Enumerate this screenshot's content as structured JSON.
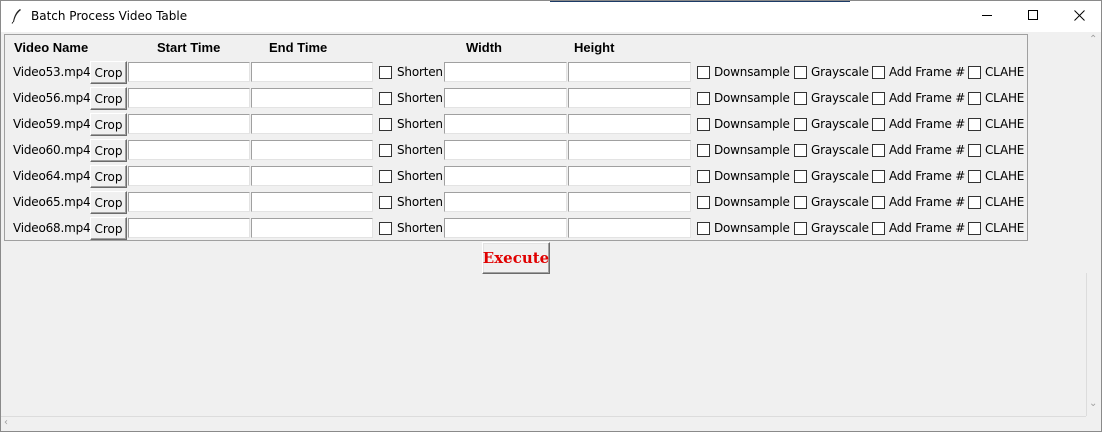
{
  "window": {
    "title": "Batch Process Video Table",
    "icons": {
      "app": "feather-icon",
      "minimize": "minimize-icon",
      "maximize": "maximize-icon",
      "close": "close-icon"
    }
  },
  "table": {
    "headers": {
      "video_name": "Video Name",
      "start_time": "Start Time",
      "end_time": "End Time",
      "width": "Width",
      "height": "Height"
    },
    "labels": {
      "crop": "Crop",
      "shorten": "Shorten",
      "downsample": "Downsample",
      "grayscale": "Grayscale",
      "add_frame": "Add Frame #",
      "clahe": "CLAHE"
    },
    "rows": [
      {
        "video": "Video53.mp4",
        "start": "",
        "end": "",
        "width": "",
        "height": "",
        "shorten": false,
        "downsample": false,
        "grayscale": false,
        "add_frame": false,
        "clahe": false
      },
      {
        "video": "Video56.mp4",
        "start": "",
        "end": "",
        "width": "",
        "height": "",
        "shorten": false,
        "downsample": false,
        "grayscale": false,
        "add_frame": false,
        "clahe": false
      },
      {
        "video": "Video59.mp4",
        "start": "",
        "end": "",
        "width": "",
        "height": "",
        "shorten": false,
        "downsample": false,
        "grayscale": false,
        "add_frame": false,
        "clahe": false
      },
      {
        "video": "Video60.mp4",
        "start": "",
        "end": "",
        "width": "",
        "height": "",
        "shorten": false,
        "downsample": false,
        "grayscale": false,
        "add_frame": false,
        "clahe": false
      },
      {
        "video": "Video64.mp4",
        "start": "",
        "end": "",
        "width": "",
        "height": "",
        "shorten": false,
        "downsample": false,
        "grayscale": false,
        "add_frame": false,
        "clahe": false
      },
      {
        "video": "Video65.mp4",
        "start": "",
        "end": "",
        "width": "",
        "height": "",
        "shorten": false,
        "downsample": false,
        "grayscale": false,
        "add_frame": false,
        "clahe": false
      },
      {
        "video": "Video68.mp4",
        "start": "",
        "end": "",
        "width": "",
        "height": "",
        "shorten": false,
        "downsample": false,
        "grayscale": false,
        "add_frame": false,
        "clahe": false
      }
    ]
  },
  "execute": {
    "label": "Execute",
    "color": "#e00000"
  }
}
